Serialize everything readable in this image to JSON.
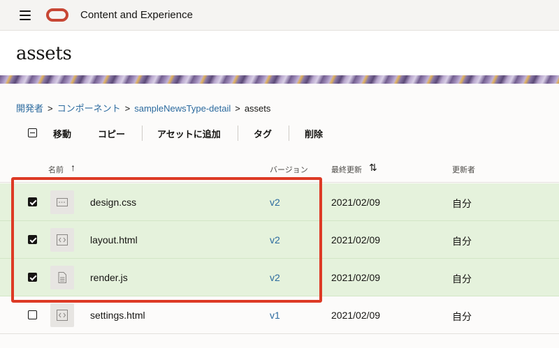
{
  "app": {
    "title": "Content and Experience"
  },
  "page": {
    "title": "assets"
  },
  "breadcrumb": [
    {
      "label": "開発者",
      "link": true
    },
    {
      "label": "コンポーネント",
      "link": true
    },
    {
      "label": "sampleNewsType-detail",
      "link": true
    },
    {
      "label": "assets",
      "link": false
    }
  ],
  "breadcrumb_separator": ">",
  "toolbar": {
    "move": "移動",
    "copy": "コピー",
    "add_to_asset": "アセットに追加",
    "tag": "タグ",
    "delete": "削除"
  },
  "columns": {
    "name": "名前",
    "name_sort": "↑",
    "version": "バージョン",
    "updated": "最終更新",
    "updated_sort": "⇅",
    "updated_by": "更新者"
  },
  "rows": [
    {
      "name": "design.css",
      "version": "v2",
      "date": "2021/02/09",
      "user": "自分",
      "checked": true,
      "icon": "css-file-icon"
    },
    {
      "name": "layout.html",
      "version": "v2",
      "date": "2021/02/09",
      "user": "自分",
      "checked": true,
      "icon": "html-file-icon"
    },
    {
      "name": "render.js",
      "version": "v2",
      "date": "2021/02/09",
      "user": "自分",
      "checked": true,
      "icon": "document-file-icon"
    },
    {
      "name": "settings.html",
      "version": "v1",
      "date": "2021/02/09",
      "user": "自分",
      "checked": false,
      "icon": "html-file-icon"
    }
  ],
  "colors": {
    "brand": "#c74634",
    "selected_row": "#e5f2dc",
    "link": "#2b6a9e",
    "highlight": "#dd3a25"
  }
}
